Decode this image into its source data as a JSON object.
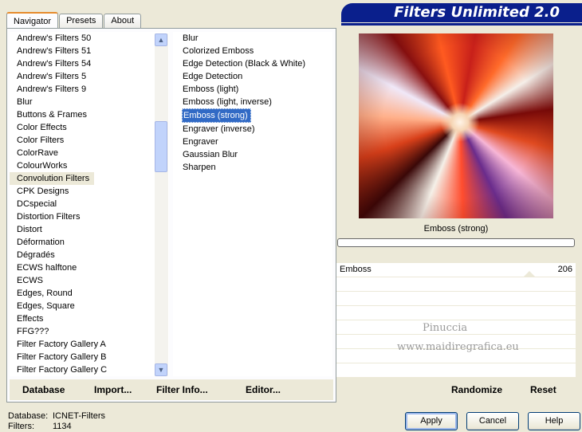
{
  "tabs": [
    "Navigator",
    "Presets",
    "About"
  ],
  "app_title": "Filters Unlimited 2.0",
  "categories": [
    "Andrew's Filters 50",
    "Andrew's Filters 51",
    "Andrew's Filters 54",
    "Andrew's Filters 5",
    "Andrew's Filters 9",
    "Blur",
    "Buttons & Frames",
    "Color Effects",
    "Color Filters",
    "ColorRave",
    "ColourWorks",
    "Convolution Filters",
    "CPK Designs",
    "DCspecial",
    "Distortion Filters",
    "Distort",
    "Déformation",
    "Dégradés",
    "ECWS halftone",
    "ECWS",
    "Edges, Round",
    "Edges, Square",
    "Effects",
    "FFG???",
    "Filter Factory Gallery A",
    "Filter Factory Gallery B",
    "Filter Factory Gallery C"
  ],
  "selected_category_index": 11,
  "filters": [
    "Blur",
    "Colorized Emboss",
    "Edge Detection (Black & White)",
    "Edge Detection",
    "Emboss (light)",
    "Emboss (light, inverse)",
    "Emboss (strong)",
    "Engraver (inverse)",
    "Engraver",
    "Gaussian Blur",
    "Sharpen"
  ],
  "selected_filter_index": 6,
  "left_buttons": {
    "database": "Database",
    "import": "Import...",
    "filter_info": "Filter Info...",
    "editor": "Editor..."
  },
  "current_filter": "Emboss (strong)",
  "slider": {
    "label": "Emboss",
    "value": "206"
  },
  "watermark": {
    "line1": "Pinuccia",
    "line2": "www.maidiregrafica.eu"
  },
  "right_buttons": {
    "randomize": "Randomize",
    "reset": "Reset"
  },
  "db_info": {
    "database_label": "Database:",
    "database_value": "ICNET-Filters",
    "filters_label": "Filters:",
    "filters_value": "1134"
  },
  "dialog_buttons": {
    "apply": "Apply",
    "cancel": "Cancel",
    "help": "Help"
  }
}
